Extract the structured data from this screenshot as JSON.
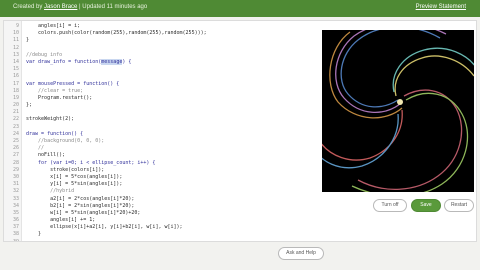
{
  "topbar": {
    "created_text": "Created by",
    "author": "Jason Brace",
    "updated_text": " | Updated 11 minutes ago",
    "preview_link": "Preview Statement"
  },
  "code_lines": [
    {
      "n": "9",
      "text": "    angles[i] = i;",
      "cls": ""
    },
    {
      "n": "10",
      "text": "    colors.push(color(random(255),random(255),random(255)));",
      "cls": ""
    },
    {
      "n": "11",
      "text": "}",
      "cls": ""
    },
    {
      "n": "12",
      "text": "",
      "cls": ""
    },
    {
      "n": "13",
      "text": "//debug info",
      "cls": "cm"
    },
    {
      "n": "14",
      "text": "var draw_info = function(message) {",
      "cls": "kw"
    },
    {
      "n": "15",
      "text": "",
      "cls": ""
    },
    {
      "n": "16",
      "text": "",
      "cls": ""
    },
    {
      "n": "17",
      "text": "var mousePressed = function() {",
      "cls": "kw"
    },
    {
      "n": "18",
      "text": "    //clear = true;",
      "cls": "cm"
    },
    {
      "n": "19",
      "text": "    Program.restart();",
      "cls": ""
    },
    {
      "n": "20",
      "text": "};",
      "cls": ""
    },
    {
      "n": "21",
      "text": "",
      "cls": ""
    },
    {
      "n": "22",
      "text": "strokeWeight(2);",
      "cls": ""
    },
    {
      "n": "23",
      "text": "",
      "cls": ""
    },
    {
      "n": "24",
      "text": "draw = function() {",
      "cls": "kw"
    },
    {
      "n": "25",
      "text": "    //background(0, 0, 0);",
      "cls": "cm"
    },
    {
      "n": "26",
      "text": "    //",
      "cls": "cm"
    },
    {
      "n": "27",
      "text": "    noFill();",
      "cls": ""
    },
    {
      "n": "28",
      "text": "    for (var i=0; i < ellipse_count; i++) {",
      "cls": "kw"
    },
    {
      "n": "29",
      "text": "        stroke(colors[i]);",
      "cls": ""
    },
    {
      "n": "30",
      "text": "        x[i] = 5*cos(angles[i]);",
      "cls": ""
    },
    {
      "n": "31",
      "text": "        y[i] = 5*sin(angles[i]);",
      "cls": ""
    },
    {
      "n": "32",
      "text": "        //hybrid",
      "cls": "cm"
    },
    {
      "n": "33",
      "text": "        a2[i] = 2*cos(angles[i]*20);",
      "cls": ""
    },
    {
      "n": "34",
      "text": "        b2[i] = 2*sin(angles[i]*20);",
      "cls": ""
    },
    {
      "n": "35",
      "text": "        w[i] = 5*sin(angles[i]*20)+20;",
      "cls": ""
    },
    {
      "n": "36",
      "text": "        angles[i] += 1;",
      "cls": ""
    },
    {
      "n": "37",
      "text": "        ellipse(x[i]+a2[i], y[i]+b2[i], w[i], w[i]);",
      "cls": ""
    },
    {
      "n": "38",
      "text": "    }",
      "cls": ""
    },
    {
      "n": "39",
      "text": "",
      "cls": ""
    },
    {
      "n": "40",
      "text": "    debug_info = \"x: \" + x + \" \"",
      "cls": ""
    },
    {
      "n": "41",
      "text": "                 \"\\ny: \" + y + \" \" +",
      "cls": ""
    }
  ],
  "highlight_token": "message",
  "buttons": {
    "turn_off": "Turn off",
    "save": "Save",
    "restart": "Restart",
    "help": "Ask and Help"
  },
  "colors": {
    "brand_green": "#4f8a34",
    "accent_green": "#5a9a3b",
    "canvas_bg": "#000000"
  }
}
